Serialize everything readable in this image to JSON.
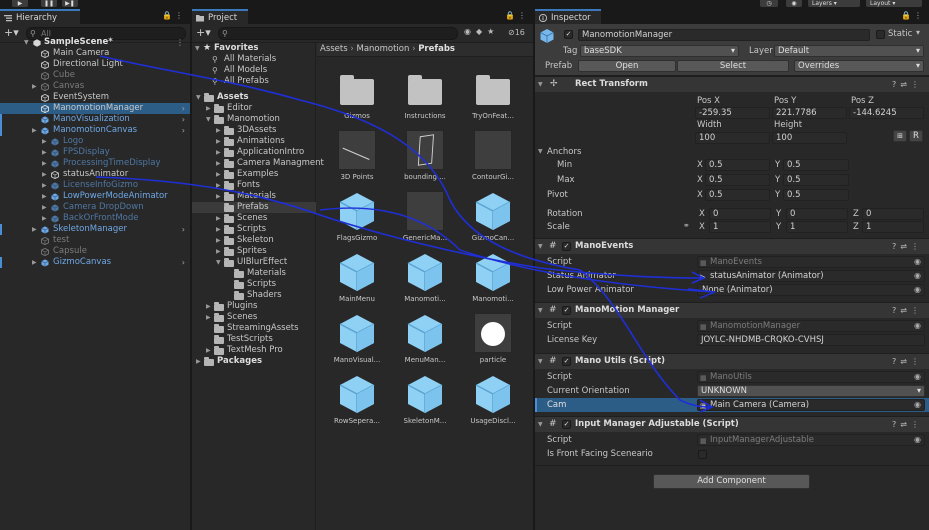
{
  "toolbar": {
    "layers_label": "Layers",
    "layout_label": "Layout"
  },
  "hierarchy": {
    "tab": "Hierarchy",
    "search_placeholder": "All",
    "scene": "SampleScene*",
    "items": [
      {
        "label": "Main Camera",
        "state": "normal",
        "indent": 1
      },
      {
        "label": "Directional Light",
        "state": "normal",
        "indent": 1
      },
      {
        "label": "Cube",
        "state": "disabled",
        "indent": 1
      },
      {
        "label": "Canvas",
        "state": "disabled",
        "indent": 1
      },
      {
        "label": "EventSystem",
        "state": "normal",
        "indent": 1
      },
      {
        "label": "ManomotionManager",
        "state": "selected",
        "indent": 1
      },
      {
        "label": "ManoVisualization",
        "state": "prefab",
        "indent": 1
      },
      {
        "label": "ManomotionCanvas",
        "state": "prefab",
        "indent": 1
      },
      {
        "label": "Logo",
        "state": "prefab-disabled",
        "indent": 2
      },
      {
        "label": "FPSDisplay",
        "state": "prefab-disabled",
        "indent": 2
      },
      {
        "label": "ProcessingTimeDisplay",
        "state": "prefab-disabled",
        "indent": 2
      },
      {
        "label": "statusAnimator",
        "state": "normal",
        "indent": 2
      },
      {
        "label": "LicenseInfoGizmo",
        "state": "prefab-disabled",
        "indent": 2
      },
      {
        "label": "LowPowerModeAnimator",
        "state": "prefab",
        "indent": 2
      },
      {
        "label": "Camera DropDown",
        "state": "prefab-disabled",
        "indent": 2
      },
      {
        "label": "BackOrFrontMode",
        "state": "prefab-disabled",
        "indent": 2
      },
      {
        "label": "SkeletonManager",
        "state": "prefab",
        "indent": 1
      },
      {
        "label": "test",
        "state": "disabled",
        "indent": 1
      },
      {
        "label": "Capsule",
        "state": "disabled",
        "indent": 1
      },
      {
        "label": "GizmoCanvas",
        "state": "prefab",
        "indent": 1
      }
    ]
  },
  "project": {
    "tab": "Project",
    "hidden_count": "16",
    "breadcrumb": [
      "Assets",
      "Manomotion",
      "Prefabs"
    ],
    "favorites": {
      "label": "Favorites",
      "items": [
        "All Materials",
        "All Models",
        "All Prefabs"
      ]
    },
    "tree": [
      {
        "label": "Assets",
        "indent": 0,
        "bold": true
      },
      {
        "label": "Editor",
        "indent": 1
      },
      {
        "label": "Manomotion",
        "indent": 1
      },
      {
        "label": "3DAssets",
        "indent": 2
      },
      {
        "label": "Animations",
        "indent": 2
      },
      {
        "label": "ApplicationIntro",
        "indent": 2
      },
      {
        "label": "Camera Managment",
        "indent": 2
      },
      {
        "label": "Examples",
        "indent": 2
      },
      {
        "label": "Fonts",
        "indent": 2
      },
      {
        "label": "Materials",
        "indent": 2
      },
      {
        "label": "Prefabs",
        "indent": 2,
        "selected": true
      },
      {
        "label": "Scenes",
        "indent": 2
      },
      {
        "label": "Scripts",
        "indent": 2
      },
      {
        "label": "Skeleton",
        "indent": 2
      },
      {
        "label": "Sprites",
        "indent": 2
      },
      {
        "label": "UIBlurEffect",
        "indent": 2
      },
      {
        "label": "Materials",
        "indent": 3
      },
      {
        "label": "Scripts",
        "indent": 3
      },
      {
        "label": "Shaders",
        "indent": 3
      },
      {
        "label": "Plugins",
        "indent": 1
      },
      {
        "label": "Scenes",
        "indent": 1
      },
      {
        "label": "StreamingAssets",
        "indent": 1
      },
      {
        "label": "TestScripts",
        "indent": 1
      },
      {
        "label": "TextMesh Pro",
        "indent": 1
      },
      {
        "label": "Packages",
        "indent": 0,
        "bold": true
      }
    ],
    "assets": [
      {
        "label": "Gizmos",
        "kind": "folder"
      },
      {
        "label": "Instructions",
        "kind": "folder"
      },
      {
        "label": "TryOnFeat...",
        "kind": "folder"
      },
      {
        "label": "3D Points",
        "kind": "thumb-line"
      },
      {
        "label": "bounding ...",
        "kind": "thumb-box"
      },
      {
        "label": "ContourGi...",
        "kind": "thumb"
      },
      {
        "label": "FlagsGizmo",
        "kind": "prefab"
      },
      {
        "label": "GenericMa...",
        "kind": "thumb"
      },
      {
        "label": "GizmoCan...",
        "kind": "prefab"
      },
      {
        "label": "MainMenu",
        "kind": "prefab"
      },
      {
        "label": "Manomoti...",
        "kind": "prefab"
      },
      {
        "label": "Manomoti...",
        "kind": "prefab"
      },
      {
        "label": "ManoVisual...",
        "kind": "prefab"
      },
      {
        "label": "MenuMan...",
        "kind": "prefab"
      },
      {
        "label": "particle",
        "kind": "circle"
      },
      {
        "label": "RowSepera...",
        "kind": "prefab"
      },
      {
        "label": "SkeletonM...",
        "kind": "prefab"
      },
      {
        "label": "UsageDiscl...",
        "kind": "prefab"
      }
    ]
  },
  "inspector": {
    "tab": "Inspector",
    "object_name": "ManomotionManager",
    "static_label": "Static",
    "tag_label": "Tag",
    "tag_value": "baseSDK",
    "layer_label": "Layer",
    "layer_value": "Default",
    "prefab_label": "Prefab",
    "open_label": "Open",
    "select_label": "Select",
    "overrides_label": "Overrides",
    "rect": {
      "title": "Rect Transform",
      "pos_x_label": "Pos X",
      "pos_y_label": "Pos Y",
      "pos_z_label": "Pos Z",
      "pos_x": "-259.35",
      "pos_y": "221.7786",
      "pos_z": "-144.6245",
      "width_label": "Width",
      "height_label": "Height",
      "width": "100",
      "height": "100",
      "r_label": "R",
      "anchors_label": "Anchors",
      "min_label": "Min",
      "max_label": "Max",
      "min_x": "0.5",
      "min_y": "0.5",
      "max_x": "0.5",
      "max_y": "0.5",
      "pivot_label": "Pivot",
      "pivot_x": "0.5",
      "pivot_y": "0.5",
      "rotation_label": "Rotation",
      "rot_x": "0",
      "rot_y": "0",
      "rot_z": "0",
      "scale_label": "Scale",
      "scale_x": "1",
      "scale_y": "1",
      "scale_z": "1",
      "x": "X",
      "y": "Y",
      "z": "Z"
    },
    "mano_events": {
      "title": "ManoEvents",
      "script_label": "Script",
      "script_value": "ManoEvents",
      "status_label": "Status Animator",
      "status_value": "statusAnimator (Animator)",
      "lowpower_label": "Low Power Animator",
      "lowpower_value": "None (Animator)"
    },
    "mano_manager": {
      "title": "ManoMotion Manager",
      "script_label": "Script",
      "script_value": "ManomotionManager",
      "license_label": "License Key",
      "license_value": "JOYLC-NHDMB-CRQKO-CVHSJ"
    },
    "mano_utils": {
      "title": "Mano Utils (Script)",
      "script_label": "Script",
      "script_value": "ManoUtils",
      "orientation_label": "Current Orientation",
      "orientation_value": "UNKNOWN",
      "cam_label": "Cam",
      "cam_value": "Main Camera (Camera)"
    },
    "input_manager": {
      "title": "Input Manager Adjustable (Script)",
      "script_label": "Script",
      "script_value": "InputManagerAdjustable",
      "front_label": "Is Front Facing Sceneario"
    },
    "add_component": "Add Component"
  },
  "colors": {
    "selection": "#2c5d87",
    "prefab_text": "#6fa8e6",
    "annotation": "#1f2fd8"
  }
}
